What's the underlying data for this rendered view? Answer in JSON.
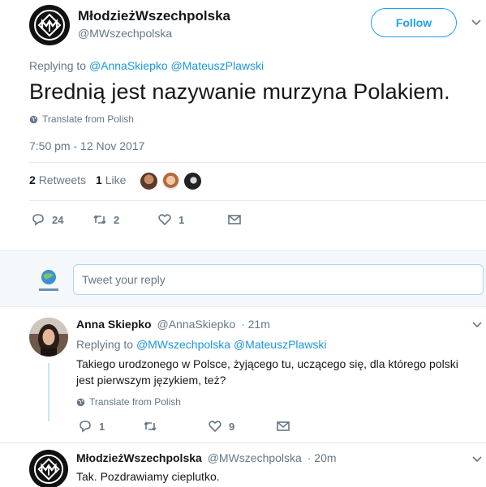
{
  "main_tweet": {
    "author_name": "MłodzieżWszechpolska",
    "author_handle": "@MWszechpolska",
    "follow_label": "Follow",
    "replying_prefix": "Replying to",
    "replying_to": [
      "@AnnaSkiepko",
      "@MateuszPlawski"
    ],
    "text": "Brednią jest nazywanie murzyna Polakiem.",
    "translate_label": "Translate from Polish",
    "timestamp": "7:50 pm - 12 Nov 2017",
    "retweets_count": "2",
    "retweets_label": "Retweets",
    "likes_count": "1",
    "likes_label": "Like",
    "reply_count": "24",
    "retweet_action_count": "2",
    "like_action_count": "1"
  },
  "reply_box": {
    "placeholder": "Tweet your reply"
  },
  "replies": [
    {
      "author_name": "Anna Skiepko",
      "author_handle": "@AnnaSkiepko",
      "time": "· 21m",
      "replying_prefix": "Replying to",
      "replying_to": [
        "@MWszechpolska",
        "@MateuszPlawski"
      ],
      "text": "Takiego urodzonego w Polsce, żyjącego tu, uczącego się, dla którego polski jest pierwszym językiem, też?",
      "translate_label": "Translate from Polish",
      "reply_count": "1",
      "retweet_count": "",
      "like_count": "9"
    },
    {
      "author_name": "MłodzieżWszechpolska",
      "author_handle": "@MWszechpolska",
      "time": "· 20m",
      "text": "Tak. Pozdrawiamy cieplutko."
    }
  ],
  "colors": {
    "accent": "#1da1f2",
    "mention": "#1b95e0",
    "secondary_text": "#657786",
    "divider": "#e6ecf0",
    "thread_line": "#c4e6fc"
  },
  "icons": [
    "mw-logo-icon",
    "chevron-down-icon",
    "globe-icon",
    "reply-icon",
    "retweet-icon",
    "like-icon",
    "message-icon"
  ]
}
